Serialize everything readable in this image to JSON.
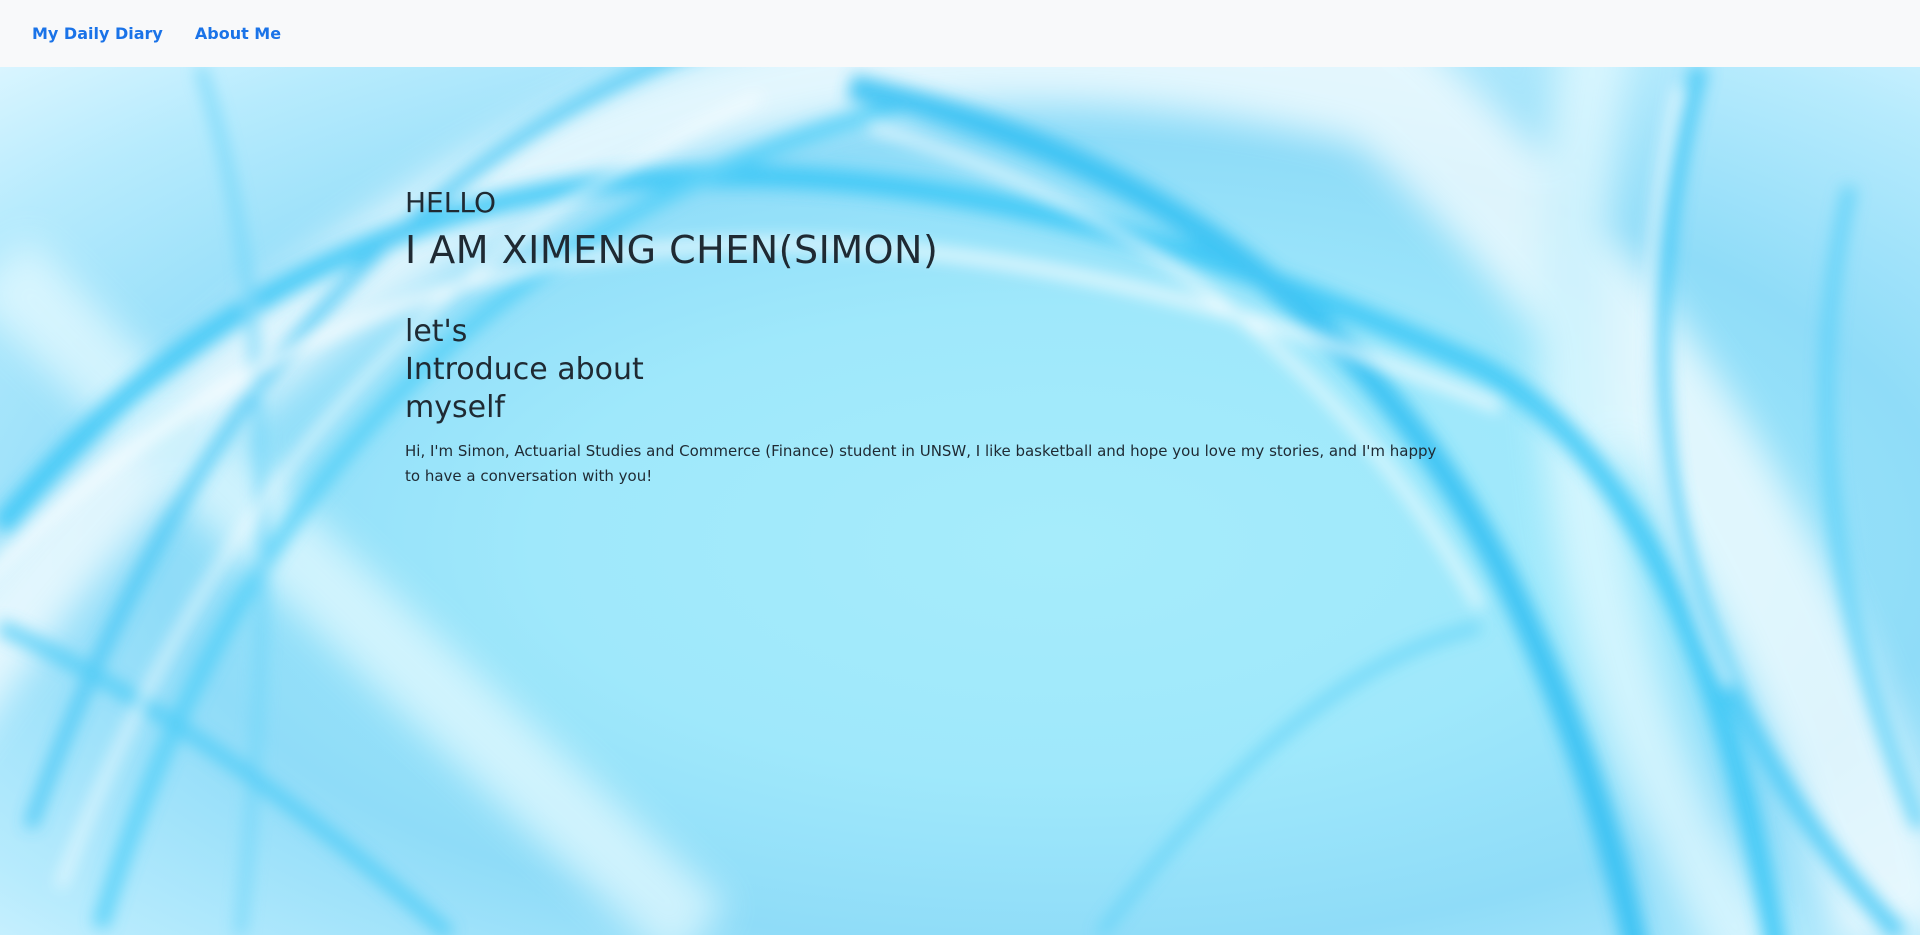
{
  "nav": {
    "brand": "My Daily Diary",
    "about": "About Me"
  },
  "hero": {
    "greeting": "HELLO",
    "name": "I AM XIMENG CHEN(SIMON)",
    "intro_line1": "let's",
    "intro_line2": "Introduce about",
    "intro_line3": "myself",
    "bio": "Hi, I'm Simon, Actuarial Studies and Commerce (Finance) student in UNSW, I like basketball and hope you love my stories, and I'm happy to have a conversation with you!"
  },
  "colors": {
    "link": "#1a73e8",
    "navbar_bg": "#f8f9fa",
    "text": "#1f2a33",
    "hero_base": "#9fe8fb"
  }
}
